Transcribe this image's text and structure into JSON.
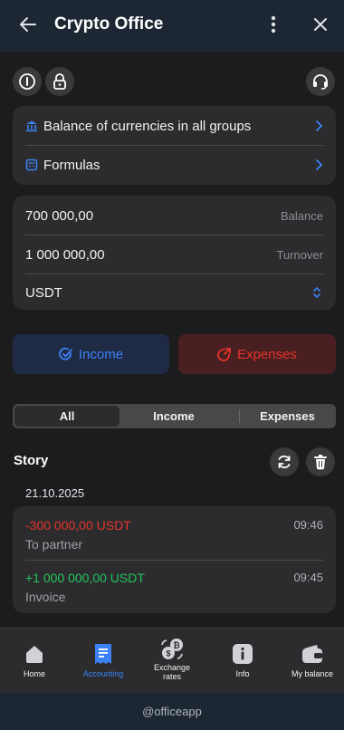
{
  "header": {
    "title": "Crypto Office"
  },
  "links": [
    {
      "label": "Balance of currencies in all groups",
      "icon": "bank-icon"
    },
    {
      "label": "Formulas",
      "icon": "calculator-icon"
    }
  ],
  "summary": {
    "balance_value": "700 000,00",
    "balance_caption": "Balance",
    "turnover_value": "1 000 000,00",
    "turnover_caption": "Turnover",
    "currency": "USDT"
  },
  "actions": {
    "income_label": "Income",
    "expenses_label": "Expenses"
  },
  "filter": {
    "options": [
      "All",
      "Income",
      "Expenses"
    ],
    "selected": "All"
  },
  "story": {
    "title": "Story",
    "date": "21.10.2025",
    "transactions": [
      {
        "amount": "-300 000,00 USDT",
        "time": "09:46",
        "note": "To partner",
        "type": "expense"
      },
      {
        "amount": "+1 000 000,00 USDT",
        "time": "09:45",
        "note": "Invoice",
        "type": "income"
      }
    ]
  },
  "nav": [
    {
      "label": "Home",
      "icon": "home-icon",
      "active": false
    },
    {
      "label": "Accounting",
      "icon": "receipt-icon",
      "active": true
    },
    {
      "label": "Exchange rates",
      "icon": "exchange-icon",
      "active": false
    },
    {
      "label": "Info",
      "icon": "info-icon",
      "active": false
    },
    {
      "label": "My balance",
      "icon": "wallet-icon",
      "active": false
    }
  ],
  "footer": {
    "handle": "@officeapp"
  },
  "colors": {
    "accent": "#3b82f6",
    "expense": "#e5332a",
    "income": "#22c55e",
    "header_bg": "#1c2733"
  }
}
